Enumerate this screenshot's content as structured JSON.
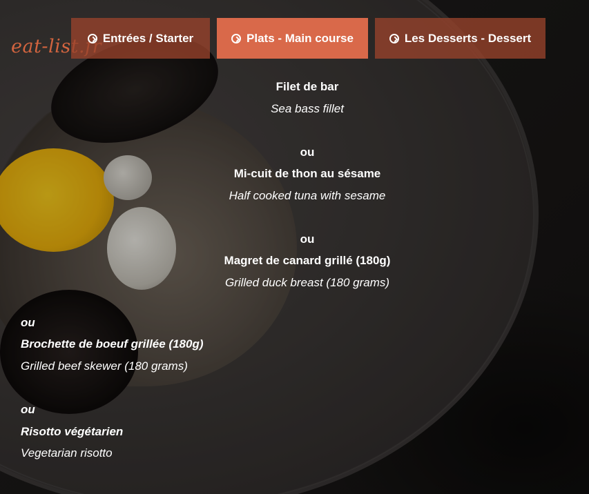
{
  "logo": "eat-list.fr",
  "tabs": [
    {
      "label": "Entrées / Starter",
      "active": false
    },
    {
      "label": "Plats - Main course",
      "active": true
    },
    {
      "label": "Les Desserts - Dessert",
      "active": false
    }
  ],
  "colors": {
    "accent": "#d9694a",
    "tab_bg": "#98432c",
    "logo": "#d2643f"
  },
  "menu": {
    "items": [
      {
        "fr": "Filet de bar",
        "en": "Sea bass fillet"
      },
      {
        "sep": "ou",
        "fr": "Mi-cuit de thon au sésame",
        "en": "Half cooked tuna with sesame"
      },
      {
        "sep": "ou",
        "fr": "Magret de canard grillé (180g)",
        "en": "Grilled duck breast (180 grams)"
      },
      {
        "sep": "ou",
        "fr": "Brochette de boeuf grillée (180g)",
        "en": "Grilled beef skewer (180 grams)"
      },
      {
        "sep": "ou",
        "fr": "Risotto végétarien",
        "en": "Vegetarian risotto"
      }
    ]
  }
}
